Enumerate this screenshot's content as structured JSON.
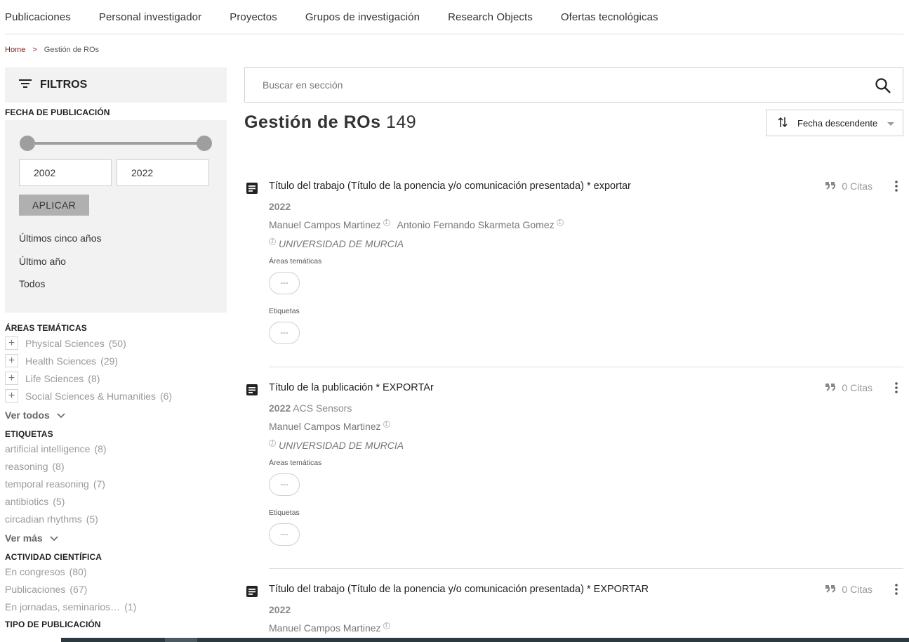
{
  "nav": [
    "Publicaciones",
    "Personal investigador",
    "Proyectos",
    "Grupos de investigación",
    "Research Objects",
    "Ofertas tecnológicas"
  ],
  "breadcrumb": {
    "home": "Home",
    "sep": ">",
    "current": "Gestión de ROs"
  },
  "filters": {
    "title": "FILTROS",
    "date_section": "FECHA DE PUBLICACIÓN",
    "date_from": "2002",
    "date_to": "2022",
    "apply": "APLICAR",
    "quick": [
      "Últimos cinco años",
      "Último año",
      "Todos"
    ],
    "areas_title": "ÁREAS TEMÁTICAS",
    "areas": [
      {
        "label": "Physical Sciences",
        "count": "(50)"
      },
      {
        "label": "Health Sciences",
        "count": "(29)"
      },
      {
        "label": "Life Sciences",
        "count": "(8)"
      },
      {
        "label": "Social Sciences & Humanities",
        "count": "(6)"
      }
    ],
    "areas_more": "Ver todos",
    "tags_title": "ETIQUETAS",
    "tags": [
      {
        "label": "artificial intelligence",
        "count": "(8)"
      },
      {
        "label": "reasoning",
        "count": "(8)"
      },
      {
        "label": "temporal reasoning",
        "count": "(7)"
      },
      {
        "label": "antibiotics",
        "count": "(5)"
      },
      {
        "label": "circadian rhythms",
        "count": "(5)"
      }
    ],
    "tags_more": "Ver más",
    "activity_title": "ACTIVIDAD CIENTÍFICA",
    "activity": [
      {
        "label": "En congresos",
        "count": "(80)"
      },
      {
        "label": "Publicaciones",
        "count": "(67)"
      },
      {
        "label": "En jornadas, seminarios…",
        "count": "(1)"
      }
    ],
    "type_title": "TIPO DE PUBLICACIÓN"
  },
  "search": {
    "placeholder": "Buscar en sección"
  },
  "page": {
    "title": "Gestión de ROs",
    "count": "149"
  },
  "sort": {
    "label": "Fecha descendente"
  },
  "results": [
    {
      "title": "Título del trabajo (Título de la ponencia y/o comunicación presentada) * exportar",
      "cites": "0 Citas",
      "year": "2022",
      "venue": "",
      "authors": [
        "Manuel Campos Martinez",
        "Antonio Fernando Skarmeta Gomez"
      ],
      "org": "UNIVERSIDAD DE MURCIA",
      "areas_label": "Áreas temáticas",
      "areas_value": "---",
      "tags_label": "Etiquetas",
      "tags_value": "---"
    },
    {
      "title": "Título de la publicación * EXPORTAr",
      "cites": "0 Citas",
      "year": "2022",
      "venue": "ACS Sensors",
      "authors": [
        "Manuel Campos Martinez"
      ],
      "org": "UNIVERSIDAD DE MURCIA",
      "areas_label": "Áreas temáticas",
      "areas_value": "---",
      "tags_label": "Etiquetas",
      "tags_value": "---"
    },
    {
      "title": "Título del trabajo (Título de la ponencia y/o comunicación presentada) * EXPORTAR",
      "cites": "0 Citas",
      "year": "2022",
      "venue": "",
      "authors": [
        "Manuel Campos Martinez"
      ]
    }
  ],
  "icons": {
    "filter": "filter-icon",
    "search": "search-icon",
    "sort": "sort-icon",
    "document": "document-icon",
    "quote": "quote-icon",
    "more": "more-vertical-icon",
    "chevron": "chevron-down-icon",
    "plus": "plus-icon"
  },
  "colors": {
    "accent": "#8b1a1a",
    "panel": "#f2f2f2",
    "muted": "#9a9a9a"
  }
}
